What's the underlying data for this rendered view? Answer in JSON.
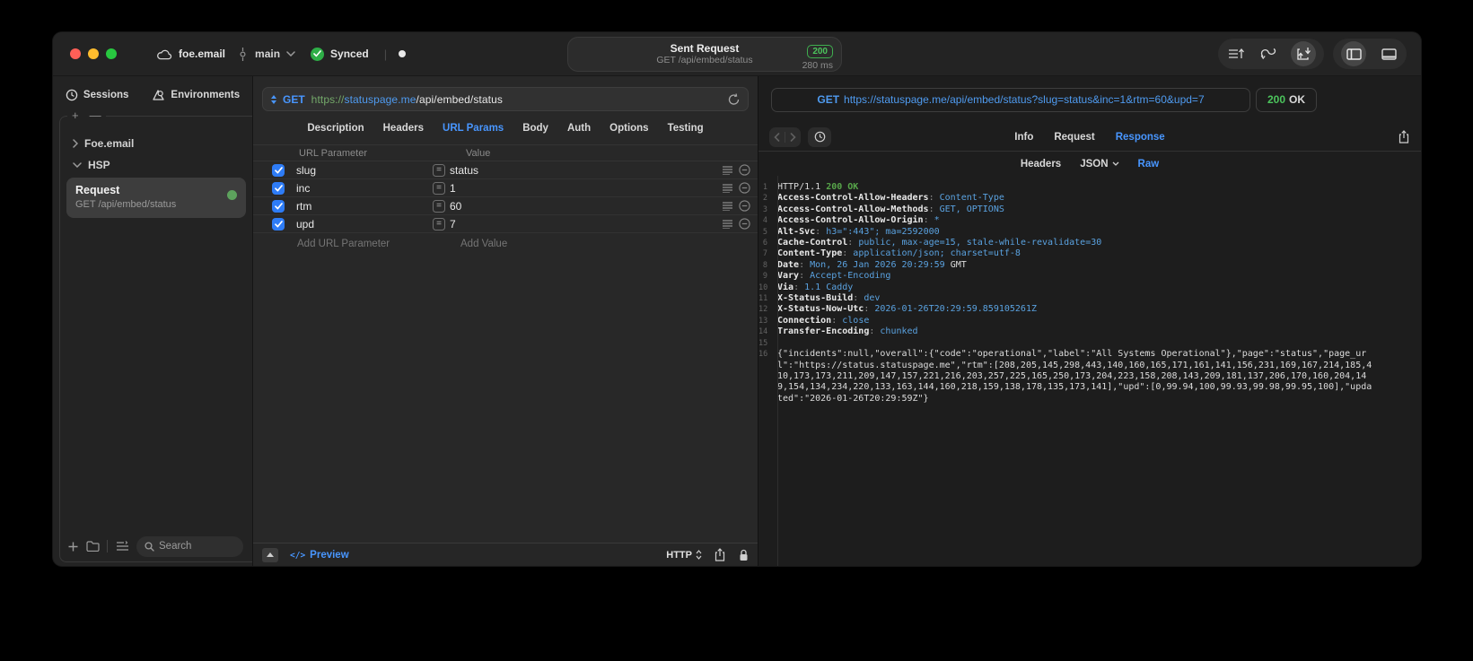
{
  "titlebar": {
    "project": "foe.email",
    "branch": "main",
    "sync_label": "Synced",
    "request_title": "Sent Request",
    "request_subtitle": "GET /api/embed/status",
    "status_code": "200",
    "duration": "280 ms"
  },
  "sidebar": {
    "tabs": [
      {
        "label": "Sessions",
        "icon": "clock-icon"
      },
      {
        "label": "Environments",
        "icon": "environments-icon"
      }
    ],
    "tree": [
      {
        "label": "Foe.email",
        "state": "collapsed"
      },
      {
        "label": "HSP",
        "state": "expanded"
      }
    ],
    "selected_request": {
      "title": "Request",
      "subtitle": "GET /api/embed/status"
    },
    "search_placeholder": "Search"
  },
  "editor": {
    "method": "GET",
    "url": {
      "scheme": "https://",
      "host": "statuspage.me",
      "path": "/api/embed/status"
    },
    "tabs": [
      "Description",
      "Headers",
      "URL Params",
      "Body",
      "Auth",
      "Options",
      "Testing"
    ],
    "active_tab": "URL Params",
    "params": {
      "columns": [
        "URL Parameter",
        "Value"
      ],
      "rows": [
        {
          "name": "slug",
          "value": "status",
          "enabled": true
        },
        {
          "name": "inc",
          "value": "1",
          "enabled": true
        },
        {
          "name": "rtm",
          "value": "60",
          "enabled": true
        },
        {
          "name": "upd",
          "value": "7",
          "enabled": true
        }
      ],
      "add_name": "Add URL Parameter",
      "add_value": "Add Value"
    },
    "footer": {
      "preview": "Preview",
      "protocol": "HTTP"
    }
  },
  "response": {
    "request_line": {
      "method": "GET",
      "url": "https://statuspage.me/api/embed/status?slug=status&inc=1&rtm=60&upd=7"
    },
    "status": {
      "code": "200",
      "text": "OK"
    },
    "tabs": [
      "Info",
      "Request",
      "Response"
    ],
    "active_tab": "Response",
    "subtabs": [
      {
        "label": "Headers"
      },
      {
        "label": "JSON",
        "dropdown": true
      },
      {
        "label": "Raw"
      }
    ],
    "active_subtab": "Raw",
    "lines": [
      {
        "n": "1",
        "parts": [
          {
            "t": "HTTP/1.1 ",
            "c": "w"
          },
          {
            "t": "200 OK",
            "c": "g"
          }
        ]
      },
      {
        "n": "2",
        "parts": [
          {
            "t": "Access-Control-Allow-Headers",
            "c": "key"
          },
          {
            "t": ": ",
            "c": "sep"
          },
          {
            "t": "Content-Type",
            "c": "val"
          }
        ]
      },
      {
        "n": "3",
        "parts": [
          {
            "t": "Access-Control-Allow-Methods",
            "c": "key"
          },
          {
            "t": ": ",
            "c": "sep"
          },
          {
            "t": "GET, OPTIONS",
            "c": "val"
          }
        ]
      },
      {
        "n": "4",
        "parts": [
          {
            "t": "Access-Control-Allow-Origin",
            "c": "key"
          },
          {
            "t": ": ",
            "c": "sep"
          },
          {
            "t": "*",
            "c": "val"
          }
        ]
      },
      {
        "n": "5",
        "parts": [
          {
            "t": "Alt-Svc",
            "c": "key"
          },
          {
            "t": ": ",
            "c": "sep"
          },
          {
            "t": "h3=\":443\"; ma=2592000",
            "c": "val"
          }
        ]
      },
      {
        "n": "6",
        "parts": [
          {
            "t": "Cache-Control",
            "c": "key"
          },
          {
            "t": ": ",
            "c": "sep"
          },
          {
            "t": "public, max-age=15, stale-while-revalidate=30",
            "c": "val"
          }
        ]
      },
      {
        "n": "7",
        "parts": [
          {
            "t": "Content-Type",
            "c": "key"
          },
          {
            "t": ": ",
            "c": "sep"
          },
          {
            "t": "application/json; charset=utf-8",
            "c": "val"
          }
        ]
      },
      {
        "n": "8",
        "parts": [
          {
            "t": "Date",
            "c": "key"
          },
          {
            "t": ": ",
            "c": "sep"
          },
          {
            "t": "Mon, 26 Jan 2026 20:29:59 ",
            "c": "val"
          },
          {
            "t": "GMT",
            "c": "w"
          }
        ]
      },
      {
        "n": "9",
        "parts": [
          {
            "t": "Vary",
            "c": "key"
          },
          {
            "t": ": ",
            "c": "sep"
          },
          {
            "t": "Accept-Encoding",
            "c": "val"
          }
        ]
      },
      {
        "n": "10",
        "parts": [
          {
            "t": "Via",
            "c": "key"
          },
          {
            "t": ": ",
            "c": "sep"
          },
          {
            "t": "1.1 Caddy",
            "c": "val"
          }
        ]
      },
      {
        "n": "11",
        "parts": [
          {
            "t": "X-Status-Build",
            "c": "key"
          },
          {
            "t": ": ",
            "c": "sep"
          },
          {
            "t": "dev",
            "c": "val"
          }
        ]
      },
      {
        "n": "12",
        "parts": [
          {
            "t": "X-Status-Now-Utc",
            "c": "key"
          },
          {
            "t": ": ",
            "c": "sep"
          },
          {
            "t": "2026-01-26T20:29:59.859105261Z",
            "c": "val"
          }
        ]
      },
      {
        "n": "13",
        "parts": [
          {
            "t": "Connection",
            "c": "key"
          },
          {
            "t": ": ",
            "c": "sep"
          },
          {
            "t": "close",
            "c": "val"
          }
        ]
      },
      {
        "n": "14",
        "parts": [
          {
            "t": "Transfer-Encoding",
            "c": "key"
          },
          {
            "t": ": ",
            "c": "sep"
          },
          {
            "t": "chunked",
            "c": "val"
          }
        ]
      },
      {
        "n": "15",
        "parts": []
      },
      {
        "n": "16",
        "parts": [
          {
            "t": "{\"incidents\":null,\"overall\":{\"code\":\"operational\",\"label\":\"All Systems Operational\"},\"page\":\"status\",\"page_url\":\"https://status.statuspage.me\",\"rtm\":[208,205,145,298,443,140,160,165,171,161,141,156,231,169,167,214,185,410,173,173,211,209,147,157,221,216,203,257,225,165,250,173,204,223,158,208,143,209,181,137,206,170,160,204,149,154,134,234,220,133,163,144,160,218,159,138,178,135,173,141],\"upd\":[0,99.94,100,99.93,99.98,99.95,100],\"updated\":\"2026-01-26T20:29:59Z\"}",
            "c": "w"
          }
        ]
      }
    ]
  },
  "colors": {
    "accent_blue": "#4896ff",
    "status_green": "#4cc45c",
    "checkbox_blue": "#2e7cf6",
    "value_blue": "#5aa2e0",
    "scheme_green": "#74a96a"
  }
}
